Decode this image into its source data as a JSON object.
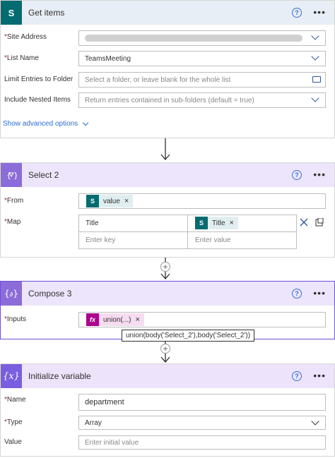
{
  "get_items": {
    "title": "Get items",
    "help": "?",
    "more": "•••",
    "site_address_label": "Site Address",
    "list_name_label": "List Name",
    "list_name_value": "TeamsMeeting",
    "limit_label": "Limit Entries to Folder",
    "limit_placeholder": "Select a folder, or leave blank for the whole list",
    "nested_label": "Include Nested Items",
    "nested_placeholder": "Return entries contained in sub-folders (default = true)",
    "advanced_link": "Show advanced options",
    "icon_letter": "S"
  },
  "select2": {
    "title": "Select 2",
    "help": "?",
    "more": "•••",
    "from_label": "From",
    "from_token": "value",
    "map_label": "Map",
    "map_key": "Title",
    "map_value_token": "Title",
    "enter_key": "Enter key",
    "enter_value": "Enter value"
  },
  "compose3": {
    "title": "Compose 3",
    "help": "?",
    "more": "•••",
    "inputs_label": "Inputs",
    "inputs_token": "union(...)",
    "tooltip": "union(body('Select_2'),body('Select_2'))",
    "fx": "fx"
  },
  "init_var": {
    "title": "Initialize variable",
    "help": "?",
    "more": "•••",
    "name_label": "Name",
    "name_value": "department",
    "type_label": "Type",
    "type_value": "Array",
    "value_label": "Value",
    "value_placeholder": "Enter initial value",
    "icon": "{x}"
  },
  "required_mark": "*",
  "token_remove": "×",
  "sp_token_icon": "S",
  "colors": {
    "sharepoint": "#036c70",
    "select_accent": "#8c6cd9",
    "variable_accent": "#7b5ee0",
    "expression": "#ad008c",
    "header_sp": "#e6eef6",
    "header_select": "#ece5fb",
    "header_var": "#ede3fb"
  }
}
